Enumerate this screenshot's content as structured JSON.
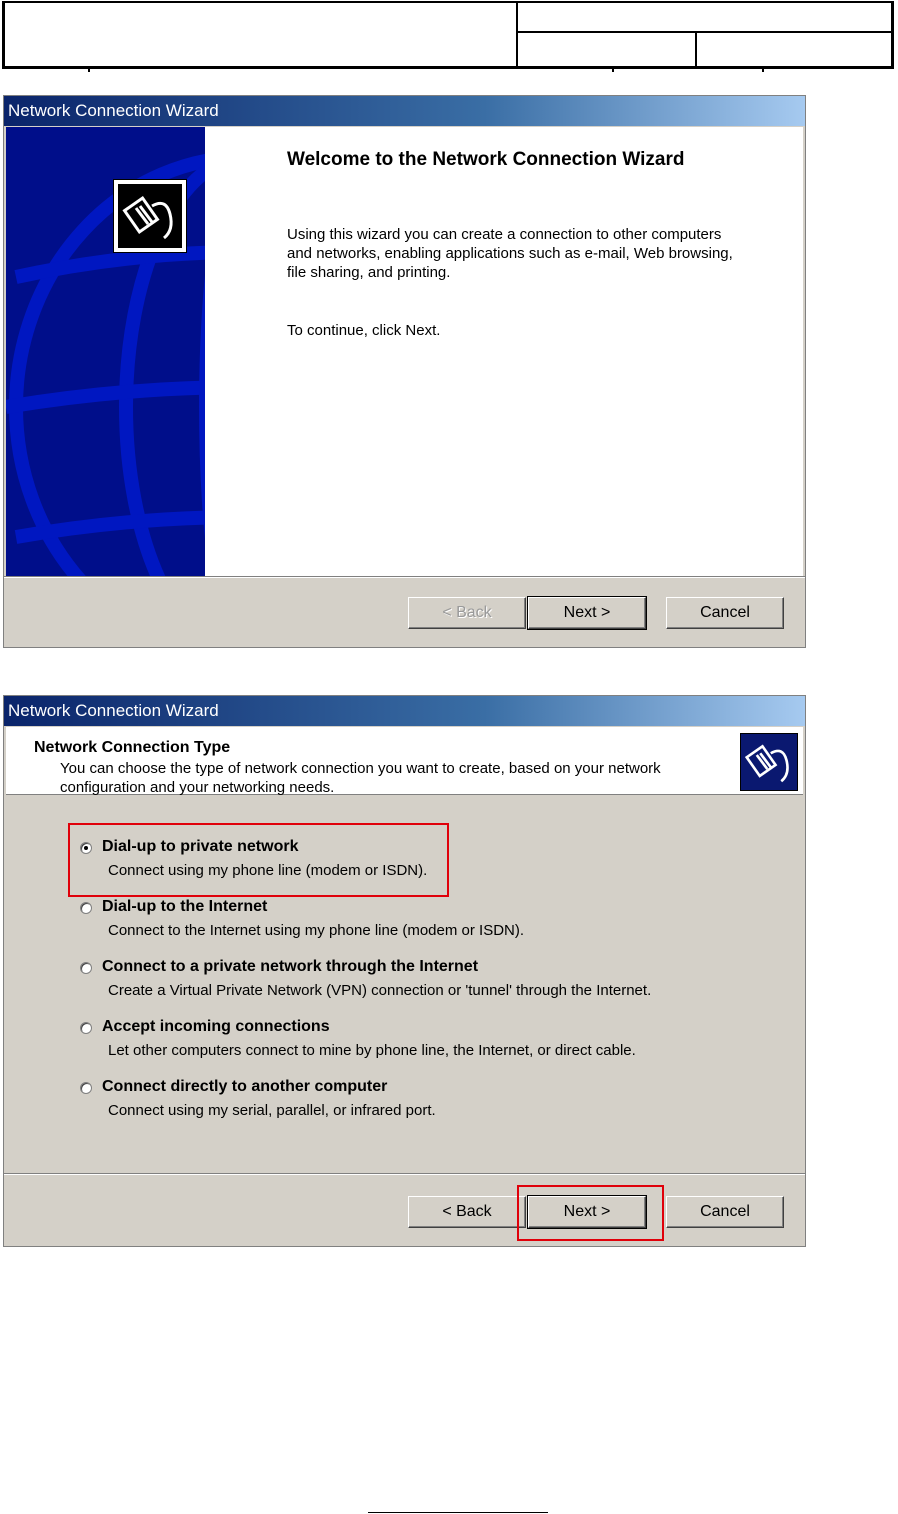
{
  "dialog1": {
    "title": "Network Connection Wizard",
    "heading": "Welcome to the Network Connection Wizard",
    "paragraph1": "Using this wizard you can create a connection to other computers and networks, enabling applications such as e-mail, Web browsing, file sharing, and printing.",
    "paragraph2": "To continue, click Next.",
    "buttons": {
      "back": "< Back",
      "next": "Next >",
      "cancel": "Cancel"
    }
  },
  "dialog2": {
    "title": "Network Connection Wizard",
    "header_title": "Network Connection Type",
    "header_subtitle": "You can choose the type of network connection you want to create, based on your network configuration and your networking needs.",
    "options": [
      {
        "label": "Dial-up to private network",
        "desc": "Connect using my phone line (modem or ISDN).",
        "selected": true
      },
      {
        "label": "Dial-up to the Internet",
        "desc": "Connect to the Internet using my phone line (modem or ISDN).",
        "selected": false
      },
      {
        "label": "Connect to a private network through the Internet",
        "desc": "Create a Virtual Private Network (VPN) connection or 'tunnel' through the Internet.",
        "selected": false
      },
      {
        "label": "Accept incoming connections",
        "desc": "Let other computers connect to mine by phone line, the Internet, or direct cable.",
        "selected": false
      },
      {
        "label": "Connect directly to another computer",
        "desc": "Connect using my serial, parallel, or infrared port.",
        "selected": false
      }
    ],
    "buttons": {
      "back": "< Back",
      "next": "Next >",
      "cancel": "Cancel"
    }
  },
  "colors": {
    "highlight": "#e0000a",
    "titlebar_start": "#0a246a",
    "dialog_bg": "#d4d0c8"
  },
  "icons": {
    "wizard_logo": "network-cable-icon"
  }
}
